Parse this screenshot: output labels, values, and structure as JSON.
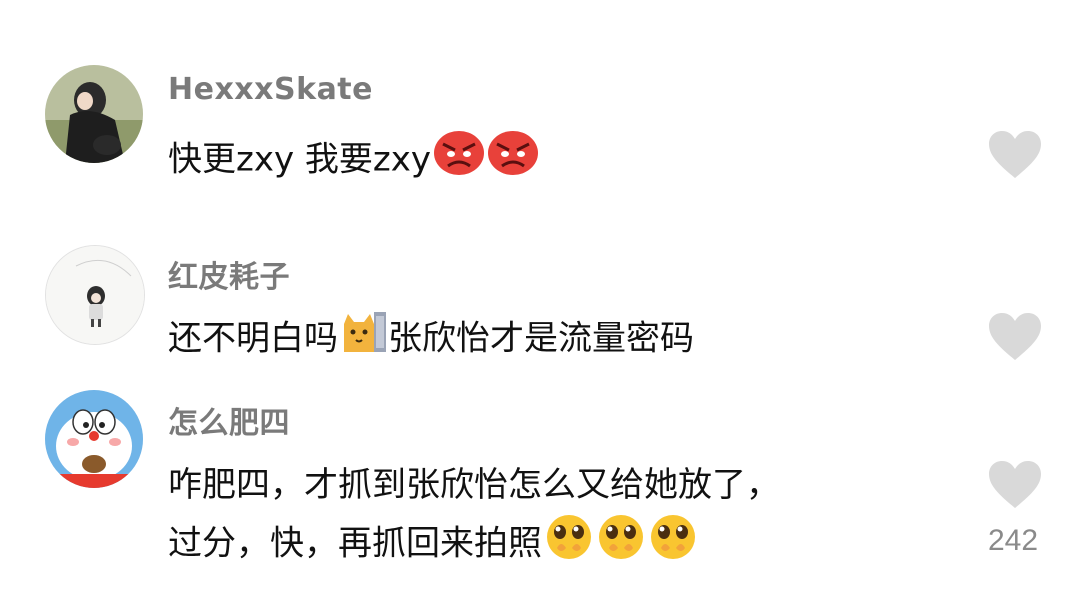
{
  "comments": [
    {
      "username": "HexxxSkate",
      "text": "快更zxy 我要zxy",
      "emojis": [
        "angry-face-icon",
        "angry-face-icon"
      ]
    },
    {
      "username": "红皮耗子",
      "text_before": "还不明白吗",
      "text_after": "张欣怡才是流量密码",
      "emojis": [
        "cat-peeking-icon"
      ]
    },
    {
      "username": "怎么肥四",
      "line1": "咋肥四，才抓到张欣怡怎么又给她放了，",
      "line2": "过分，快，再抓回来拍照",
      "emojis": [
        "pleading-face-icon",
        "pleading-face-icon",
        "pleading-face-icon"
      ],
      "likes": "242"
    }
  ],
  "colors": {
    "username": "#7a7a7a",
    "text": "#111111",
    "heart": "#d9d9d9",
    "likes": "#8a8a8a"
  }
}
